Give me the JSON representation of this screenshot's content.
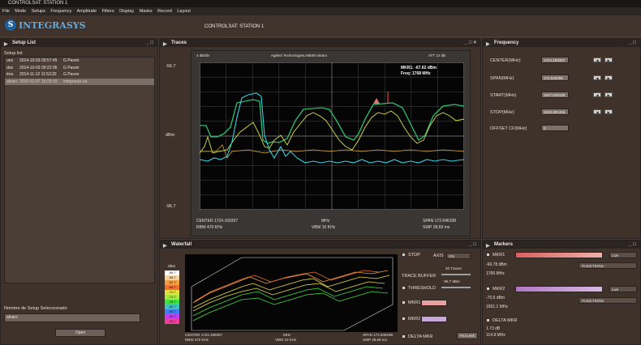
{
  "window": {
    "title": "CONTROLSAT: STATION 1"
  },
  "menu": [
    "File",
    "Mode",
    "Setups",
    "Frequency",
    "Amplitude",
    "Filters",
    "Display",
    "Masks",
    "Record",
    "Layout"
  ],
  "header": {
    "logo_text": "INTEGRASYS",
    "station_label": "CONTROLSAT: STATION 1"
  },
  "setup_list": {
    "title": "Setup List",
    "subtitle": "Setup list",
    "rows": [
      {
        "name": "uno",
        "date": "2014-10-03 09:57:45",
        "user": "G Pavon",
        "selected": false
      },
      {
        "name": "dos",
        "date": "2014-10-03 09:22:36",
        "user": "G Pavon",
        "selected": false
      },
      {
        "name": "tres",
        "date": "2014-11-12 11:53:32",
        "user": "G Pavon",
        "selected": false
      },
      {
        "name": "alvaro",
        "date": "2015-01-07 15:23:10",
        "user": "integrasys sa",
        "selected": true
      }
    ],
    "selected_label": "Nombre de Setup Seleccionado",
    "selected_value": "alvaro",
    "open_button": "Open"
  },
  "traces": {
    "title": "Traces",
    "top_left": "4 dB/div",
    "instrument": "Agilent Technologies,N9000 alvaro",
    "att": "ATT 12 dB",
    "y_top": "-56.7",
    "y_mid": "dBm",
    "y_bottom": "-96.7",
    "marker_readout_1": "MKR1: -67.62 dBm",
    "marker_readout_2": "Freq: 1768 MHz",
    "center": "CENTER 1724.169307",
    "rbw": "RBW 470 KHz",
    "x_unit": "MHz",
    "vbw": "VBW 10 KHz",
    "span": "SPAN 172.646298",
    "swp": "SWP 28.69 ms"
  },
  "frequency": {
    "title": "Frequency",
    "fields": [
      {
        "label": "CENTER(MHz)",
        "value": "1724.169307"
      },
      {
        "label": "SPAN(MHz)",
        "value": "172.646298"
      },
      {
        "label": "START(MHz)",
        "value": "1647.845158"
      },
      {
        "label": "STOP(MHz)",
        "value": "1820.491456"
      }
    ],
    "offset_label": "OFFSET CF(MHz)",
    "offset_value": "0"
  },
  "waterfall": {
    "title": "Waterfall",
    "unit": "dBm",
    "legend": [
      "-56.7",
      "-58.7",
      "-62.7",
      "-66.7",
      "-70.7",
      "-74.7",
      "-78.7",
      "-82.7",
      "-86.7",
      "-90.7",
      "-94.7"
    ],
    "legend_colors": [
      "#ffffff",
      "#f4d3a3",
      "#f0a040",
      "#f07030",
      "#e8e040",
      "#a8e840",
      "#40e040",
      "#40c0c0",
      "#4080f0",
      "#c040f0",
      "#f040a0"
    ],
    "center": "CENTER 1724.169307",
    "rbw": "RBW 470 KHz",
    "x_unit": "MHz",
    "vbw": "VBW 10 KHz",
    "span": "SPAN 172.646298",
    "swp": "SWP 28.69 ms",
    "stop_label": "STOP",
    "axis_label": "AXIS",
    "axis_value": "ON",
    "traces_label": "20 Traces",
    "trace_buffer_label": "TRACE BUFFER",
    "threshold_label": "THRESHOLD",
    "threshold_value": "-96.7 dBm",
    "mkr1_label": "MKR1",
    "mkr2_label": "MKR2",
    "delta_label": "DELTA MKR",
    "resume_button": "RESUME"
  },
  "markers": {
    "title": "Markers",
    "m1_label": "MKR1",
    "m1_mode": "Live",
    "m1_level": "-66.78 dBm",
    "m1_freq": "1766 MHz",
    "m1_func": "-FUNCTIONS-",
    "m2_label": "MKR2",
    "m2_mode": "Live",
    "m2_level": "-70.5 dBm",
    "m2_freq": "1651.1 MHz",
    "m2_func": "-FUNCTIONS-",
    "delta_label": "DELTA MKR",
    "delta_db": "1.73 dB",
    "delta_mhz": "114.9 MHz",
    "colors": {
      "m1": "#e86a62",
      "m2": "#c08cd0"
    }
  }
}
